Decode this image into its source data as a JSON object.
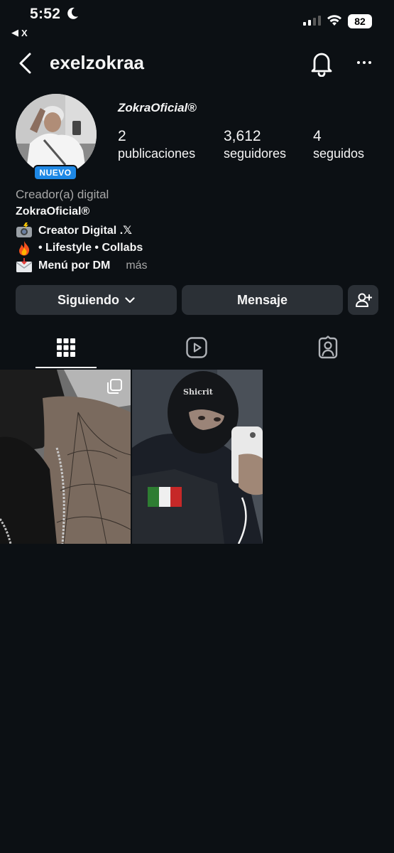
{
  "status_bar": {
    "time": "5:52",
    "back_app": "X",
    "battery": "82"
  },
  "header": {
    "username": "exelzokraa"
  },
  "profile": {
    "display_name": "ZokraOficial®",
    "badge": "NUEVO",
    "stats": [
      {
        "value": "2",
        "label": "publicaciones"
      },
      {
        "value": "3,612",
        "label": "seguidores"
      },
      {
        "value": "4",
        "label": "seguidos"
      }
    ],
    "category": "Creador(a) digital",
    "bio_name": "ZokraOficial®",
    "bio_lines": [
      {
        "icon": "camera-flash-icon",
        "text": "Creator Digital .𝕏"
      },
      {
        "icon": "fire-icon",
        "text": "• Lifestyle • Collabs"
      },
      {
        "icon": "envelope-icon",
        "text": "Menú por DM"
      }
    ],
    "more_label": "más"
  },
  "actions": {
    "following_label": "Siguiendo",
    "message_label": "Mensaje"
  },
  "tabs": [
    {
      "icon": "grid-icon",
      "active": true
    },
    {
      "icon": "reels-icon",
      "active": false
    },
    {
      "icon": "tagged-icon",
      "active": false
    }
  ],
  "posts": [
    {
      "kind": "carousel",
      "description_icon": "carousel-icon"
    },
    {
      "kind": "photo"
    }
  ],
  "colors": {
    "background": "#0c1014",
    "button": "#2b3036",
    "badge": "#1e88e5",
    "secondary_text": "#a8a8a8"
  }
}
